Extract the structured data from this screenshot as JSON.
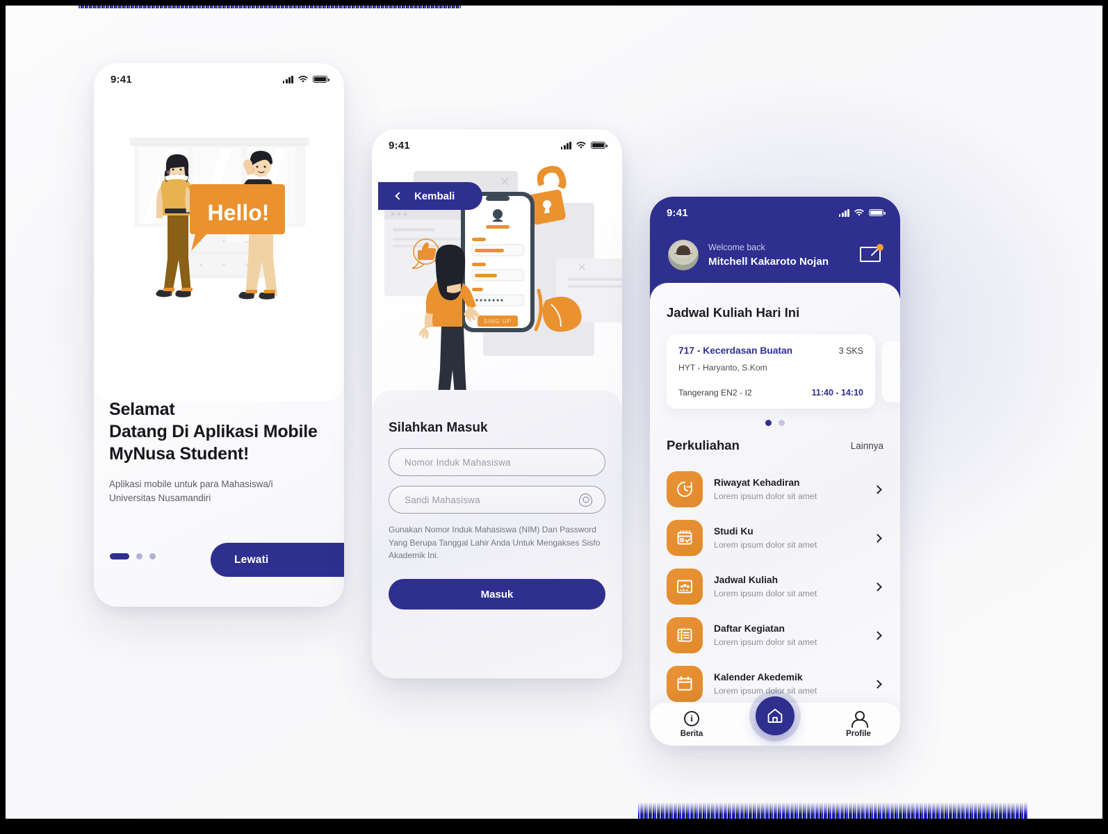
{
  "status_bar": {
    "time": "9:41"
  },
  "screen_onboarding": {
    "illustration_text": "Hello!",
    "headline_line1": "Selamat",
    "headline_line2": "Datang Di Aplikasi Mobile",
    "headline_line3": "MyNusa Student!",
    "subcopy_line1": "Aplikasi mobile untuk para Mahasiswa/i",
    "subcopy_line2": "Universitas Nusamandiri",
    "skip_label": "Lewati",
    "pager": {
      "total": 3,
      "active": 1
    }
  },
  "screen_login": {
    "back_label": "Kembali",
    "illustration_button": "SING UP",
    "title": "Silahkan Masuk",
    "nim_placeholder": "Nomor Induk Mahasiswa",
    "password_placeholder": "Sandi Mahasiswa",
    "hint": "Gunakan Nomor Induk Mahasiswa (NIM) Dan Password Yang Berupa Tanggal Lahir Anda Untuk Mengakses Sisfo Akademik Ini.",
    "submit_label": "Masuk"
  },
  "screen_home": {
    "welcome_label": "Welcome back",
    "user_name": "Mitchell Kakaroto Nojan",
    "schedule_title": "Jadwal Kuliah Hari Ini",
    "schedule_card": {
      "course": "717 - Kecerdasan Buatan",
      "credits": "3 SKS",
      "lecturer": "HYT - Haryanto, S.Kom",
      "room": "Tangerang  EN2 - I2",
      "time": "11:40 - 14:10"
    },
    "carousel": {
      "total": 2,
      "active": 1
    },
    "section_title": "Perkuliahan",
    "more_label": "Lainnya",
    "menu_items": [
      {
        "title": "Riwayat Kehadiran",
        "subtitle": "Lorem ipsum dolor sit amet",
        "icon": "history-clock-icon"
      },
      {
        "title": "Studi Ku",
        "subtitle": "Lorem ipsum dolor sit amet",
        "icon": "calendar-check-icon"
      },
      {
        "title": "Jadwal Kuliah",
        "subtitle": "Lorem ipsum dolor sit amet",
        "icon": "classroom-board-icon"
      },
      {
        "title": "Daftar Kegiatan",
        "subtitle": "Lorem ipsum dolor sit amet",
        "icon": "list-icon"
      },
      {
        "title": "Kalender Akedemik",
        "subtitle": "Lorem ipsum dolor sit amet",
        "icon": "calendar-icon"
      }
    ],
    "tabs": [
      {
        "label": "Berita",
        "icon": "info-icon"
      },
      {
        "label": "",
        "icon": "home-icon"
      },
      {
        "label": "Profile",
        "icon": "person-icon"
      }
    ]
  },
  "colors": {
    "primary": "#2e2f8f",
    "accent": "#e9922f",
    "badge": "#f0a02f",
    "text": "#1b1b21",
    "muted": "#8d8d99"
  }
}
